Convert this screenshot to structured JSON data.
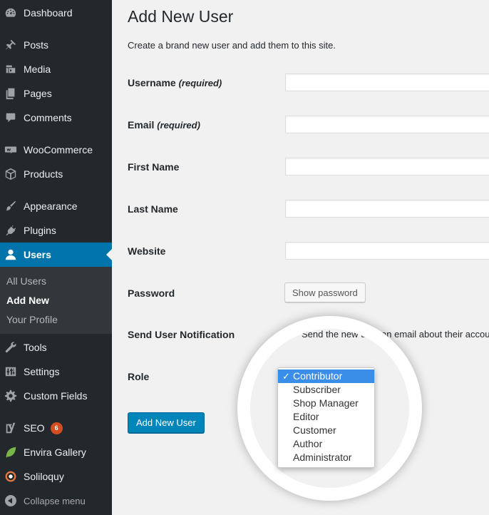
{
  "sidebar": {
    "items": [
      {
        "label": "Dashboard",
        "icon": "dashboard-icon"
      },
      {
        "label": "Posts",
        "icon": "pin-icon"
      },
      {
        "label": "Media",
        "icon": "media-icon"
      },
      {
        "label": "Pages",
        "icon": "pages-icon"
      },
      {
        "label": "Comments",
        "icon": "comment-icon"
      },
      {
        "label": "WooCommerce",
        "icon": "woo-icon"
      },
      {
        "label": "Products",
        "icon": "box-icon"
      },
      {
        "label": "Appearance",
        "icon": "brush-icon"
      },
      {
        "label": "Plugins",
        "icon": "plug-icon"
      },
      {
        "label": "Users",
        "icon": "user-icon"
      },
      {
        "label": "Tools",
        "icon": "wrench-icon"
      },
      {
        "label": "Settings",
        "icon": "sliders-icon"
      },
      {
        "label": "Custom Fields",
        "icon": "gear-icon"
      },
      {
        "label": "SEO",
        "icon": "yoast-icon",
        "badge": "6"
      },
      {
        "label": "Envira Gallery",
        "icon": "leaf-icon"
      },
      {
        "label": "Soliloquy",
        "icon": "ring-icon"
      }
    ],
    "submenu": [
      "All Users",
      "Add New",
      "Your Profile"
    ],
    "collapse_label": "Collapse menu"
  },
  "main": {
    "title": "Add New User",
    "description": "Create a brand new user and add them to this site.",
    "fields": {
      "username": "Username",
      "email": "Email",
      "required": "(required)",
      "first_name": "First Name",
      "last_name": "Last Name",
      "website": "Website",
      "password": "Password",
      "notification": "Send User Notification",
      "role": "Role"
    },
    "show_password_label": "Show password",
    "notification_text": "Send the new user an email about their account.",
    "submit_label": "Add New User"
  },
  "role_dropdown": {
    "selected": "Contributor",
    "options": [
      "Contributor",
      "Subscriber",
      "Shop Manager",
      "Editor",
      "Customer",
      "Author",
      "Administrator"
    ]
  },
  "colors": {
    "sidebar_bg": "#23282d",
    "accent": "#0073aa",
    "badge": "#d54e21"
  }
}
